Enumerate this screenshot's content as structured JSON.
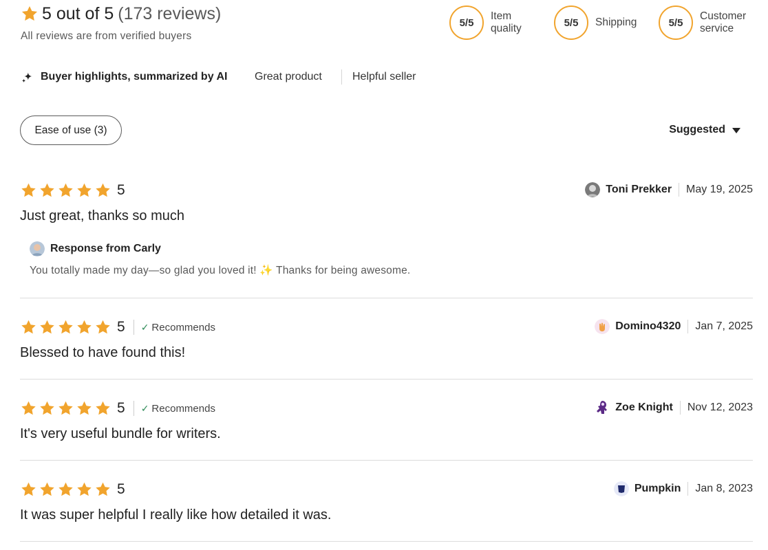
{
  "summary": {
    "rating_text": "5 out of 5",
    "count_text": "(173 reviews)",
    "verified_text": "All reviews are from verified buyers",
    "star_color": "#f1a42d"
  },
  "scores": [
    {
      "value": "5/5",
      "label_line1": "Item",
      "label_line2": "quality"
    },
    {
      "value": "5/5",
      "label_line1": "Shipping",
      "label_line2": ""
    },
    {
      "value": "5/5",
      "label_line1": "Customer",
      "label_line2": "service"
    }
  ],
  "highlights": {
    "title": "Buyer highlights, summarized by AI",
    "items": [
      "Great product",
      "Helpful seller"
    ]
  },
  "filters": {
    "chip_label": "Ease of use (3)",
    "sort_label": "Suggested"
  },
  "reviews": [
    {
      "rating": "5",
      "recommends": "",
      "text": "Just great, thanks so much",
      "reviewer": "Toni Prekker",
      "date": "May 19, 2025",
      "avatar_icon": "person-photo-icon",
      "response": {
        "title": "Response from Carly",
        "text_before": "You totally made my day—so glad you loved it! ",
        "emoji": "✨",
        "text_after": " Thanks for being awesome."
      }
    },
    {
      "rating": "5",
      "recommends": "Recommends",
      "text": "Blessed to have found this!",
      "reviewer": "Domino4320",
      "date": "Jan 7, 2025",
      "avatar_icon": "orange-hand-icon"
    },
    {
      "rating": "5",
      "recommends": "Recommends",
      "text": "It's very useful bundle for writers.",
      "reviewer": "Zoe Knight",
      "date": "Nov 12, 2023",
      "avatar_icon": "purple-figure-icon"
    },
    {
      "rating": "5",
      "recommends": "",
      "text": "It was super helpful I really like how detailed it was.",
      "reviewer": "Pumpkin",
      "date": "Jan 8, 2023",
      "avatar_icon": "navy-shape-icon"
    }
  ]
}
